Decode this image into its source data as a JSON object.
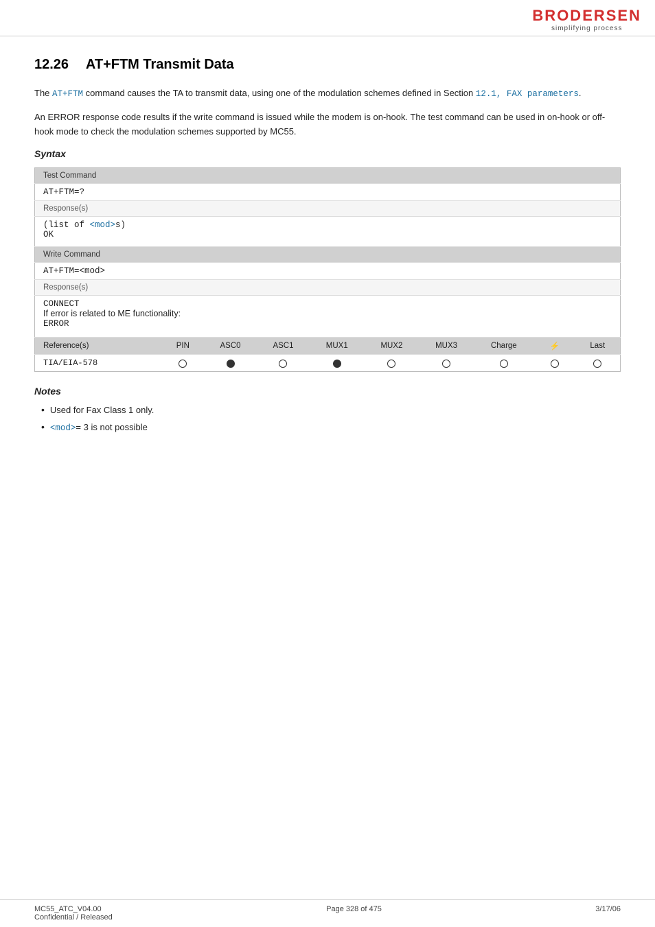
{
  "header": {
    "logo_name": "BRODERSEN",
    "logo_sub": "simplifying process"
  },
  "section": {
    "number": "12.26",
    "title": "AT+FTM   Transmit Data"
  },
  "paragraphs": [
    {
      "id": "p1",
      "text_before": "The ",
      "code": "AT+FTM",
      "text_after": " command causes the TA to transmit data, using one of the modulation schemes defined in Section ",
      "link": "12.1, FAX parameters",
      "text_end": "."
    },
    {
      "id": "p2",
      "text": "An ERROR response code results if the write command is issued while the modem is on-hook. The test command can be used in on-hook or off-hook mode to check the modulation schemes supported by MC55."
    }
  ],
  "syntax": {
    "heading": "Syntax",
    "test_command": {
      "label": "Test Command",
      "command": "AT+FTM=?",
      "response_label": "Response(s)",
      "response": "(list of <mod>s)\nOK"
    },
    "write_command": {
      "label": "Write Command",
      "command": "AT+FTM=<mod>",
      "response_label": "Response(s)",
      "response_lines": [
        "CONNECT",
        "If error is related to ME functionality:",
        "ERROR"
      ]
    },
    "reference": {
      "label": "Reference(s)",
      "columns": [
        "PIN",
        "ASC0",
        "ASC1",
        "MUX1",
        "MUX2",
        "MUX3",
        "Charge",
        "⚡",
        "Last"
      ],
      "rows": [
        {
          "name": "TIA/EIA-578",
          "values": [
            "empty",
            "filled",
            "empty",
            "filled",
            "empty",
            "empty",
            "empty",
            "empty",
            "empty"
          ]
        }
      ]
    }
  },
  "notes": {
    "heading": "Notes",
    "items": [
      "Used for Fax Class 1 only.",
      "<mod>= 3 is not possible"
    ],
    "item_codes": [
      "",
      "<mod>"
    ],
    "item_texts": [
      "Used for Fax Class 1 only.",
      "= 3 is not possible"
    ]
  },
  "footer": {
    "left_line1": "MC55_ATC_V04.00",
    "left_line2": "Confidential / Released",
    "center": "Page 328 of 475",
    "right": "3/17/06"
  }
}
